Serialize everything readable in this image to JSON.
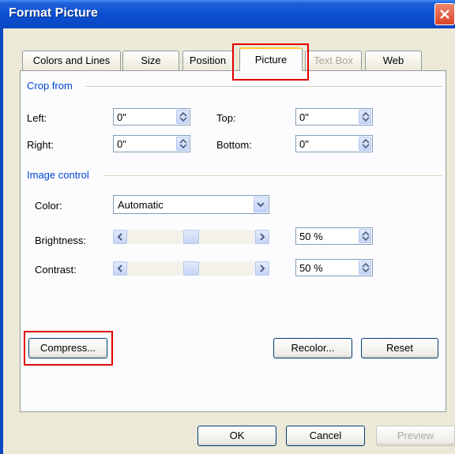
{
  "window": {
    "title": "Format Picture"
  },
  "tabs": [
    {
      "label": "Colors and Lines",
      "state": "normal"
    },
    {
      "label": "Size",
      "state": "normal"
    },
    {
      "label": "Position",
      "state": "normal"
    },
    {
      "label": "Picture",
      "state": "selected"
    },
    {
      "label": "Text Box",
      "state": "disabled"
    },
    {
      "label": "Web",
      "state": "normal"
    }
  ],
  "crop": {
    "section_label": "Crop from",
    "left_label": "Left:",
    "left_value": "0\"",
    "top_label": "Top:",
    "top_value": "0\"",
    "right_label": "Right:",
    "right_value": "0\"",
    "bottom_label": "Bottom:",
    "bottom_value": "0\""
  },
  "image_control": {
    "section_label": "Image control",
    "color_label": "Color:",
    "color_value": "Automatic",
    "brightness_label": "Brightness:",
    "brightness_value": "50 %",
    "brightness_level": 0.5,
    "contrast_label": "Contrast:",
    "contrast_value": "50 %",
    "contrast_level": 0.5
  },
  "buttons": {
    "compress": "Compress...",
    "recolor": "Recolor...",
    "reset": "Reset",
    "ok": "OK",
    "cancel": "Cancel",
    "preview": "Preview"
  },
  "colors": {
    "titlebar": "#0a47c3",
    "section_label": "#0046d5",
    "highlight": "#e00000"
  }
}
